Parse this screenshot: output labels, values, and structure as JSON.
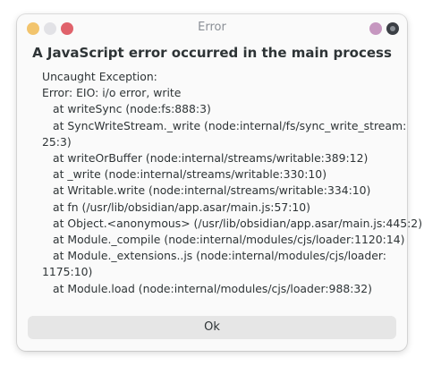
{
  "window": {
    "title": "Error",
    "buttons": [
      {
        "name": "yellow-window-button",
        "color": "#f2c46d"
      },
      {
        "name": "gray-window-button",
        "color": "#e2e2e6"
      },
      {
        "name": "red-window-button",
        "color": "#e0626b"
      },
      {
        "name": "mauve-window-button",
        "color": "#c697c0"
      },
      {
        "name": "dark-window-button",
        "color": "#3b3f45"
      }
    ]
  },
  "dialog": {
    "heading": "A JavaScript error occurred in the main process",
    "lines": [
      "Uncaught Exception:",
      "Error: EIO: i/o error, write",
      "at writeSync (node:fs:888:3)",
      "at SyncWriteStream._write (node:internal/fs/sync_write_stream:",
      "25:3)",
      "at writeOrBuffer (node:internal/streams/writable:389:12)",
      "at _write (node:internal/streams/writable:330:10)",
      "at Writable.write (node:internal/streams/writable:334:10)",
      "at fn (/usr/lib/obsidian/app.asar/main.js:57:10)",
      "at Object.<anonymous> (/usr/lib/obsidian/app.asar/main.js:445:2)",
      "at Module._compile (node:internal/modules/cjs/loader:1120:14)",
      "at Module._extensions..js (node:internal/modules/cjs/loader:",
      "1175:10)",
      "at Module.load (node:internal/modules/cjs/loader:988:32)"
    ],
    "ok_label": "Ok"
  }
}
